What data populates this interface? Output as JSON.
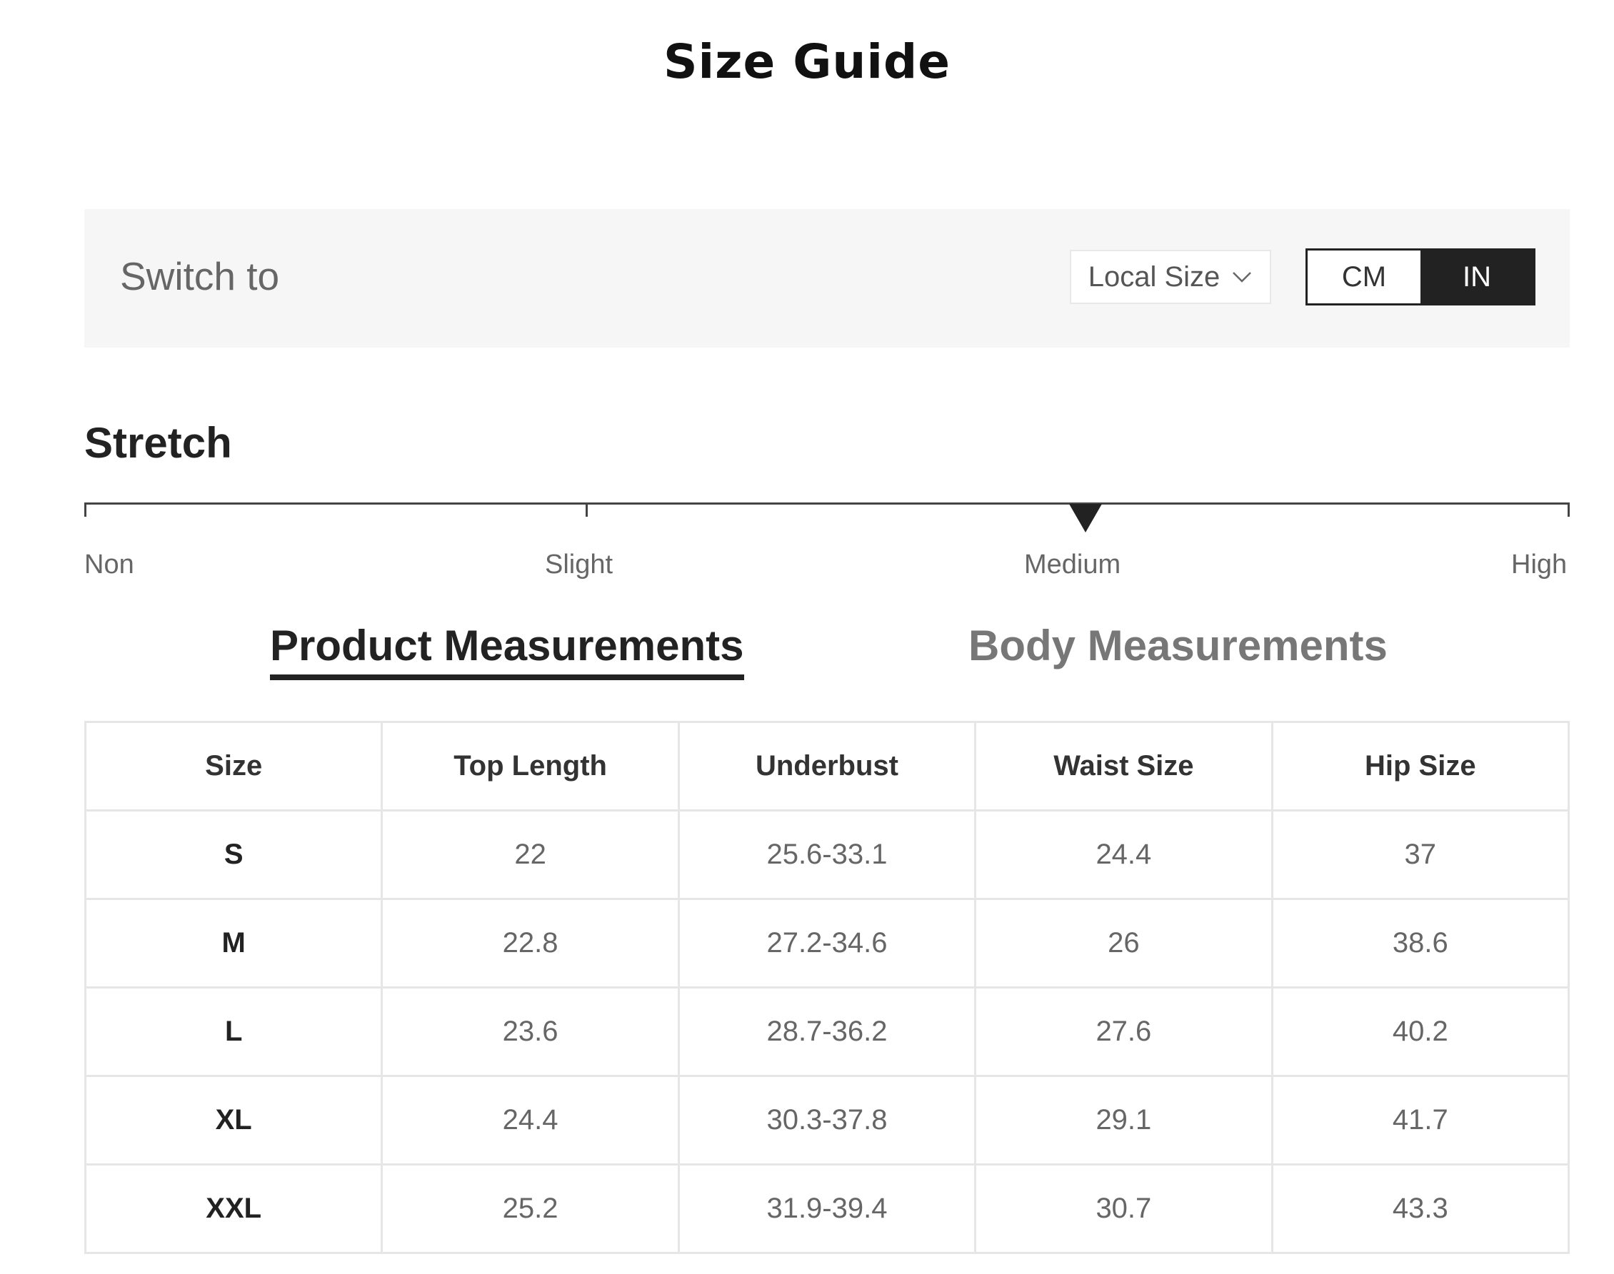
{
  "page": {
    "title": "Size Guide"
  },
  "switch_bar": {
    "label": "Switch to",
    "local_size": {
      "label": "Local Size",
      "icon": "chevron-down-icon"
    },
    "units": [
      {
        "label": "CM",
        "selected": false
      },
      {
        "label": "IN",
        "selected": true
      }
    ]
  },
  "stretch": {
    "title": "Stretch",
    "levels": [
      "Non",
      "Slight",
      "Medium",
      "High"
    ],
    "selected": "Medium"
  },
  "tabs": [
    {
      "label": "Product Measurements",
      "active": true
    },
    {
      "label": "Body Measurements",
      "active": false
    }
  ],
  "table": {
    "columns": [
      "Size",
      "Top Length",
      "Underbust",
      "Waist Size",
      "Hip Size"
    ],
    "rows": [
      [
        "S",
        "22",
        "25.6-33.1",
        "24.4",
        "37"
      ],
      [
        "M",
        "22.8",
        "27.2-34.6",
        "26",
        "38.6"
      ],
      [
        "L",
        "23.6",
        "28.7-36.2",
        "27.6",
        "40.2"
      ],
      [
        "XL",
        "24.4",
        "30.3-37.8",
        "29.1",
        "41.7"
      ],
      [
        "XXL",
        "25.2",
        "31.9-39.4",
        "30.7",
        "43.3"
      ]
    ]
  },
  "colors": {
    "accent": "#222222",
    "panel_background": "#f6f6f6",
    "border": "#e6e6e6"
  }
}
